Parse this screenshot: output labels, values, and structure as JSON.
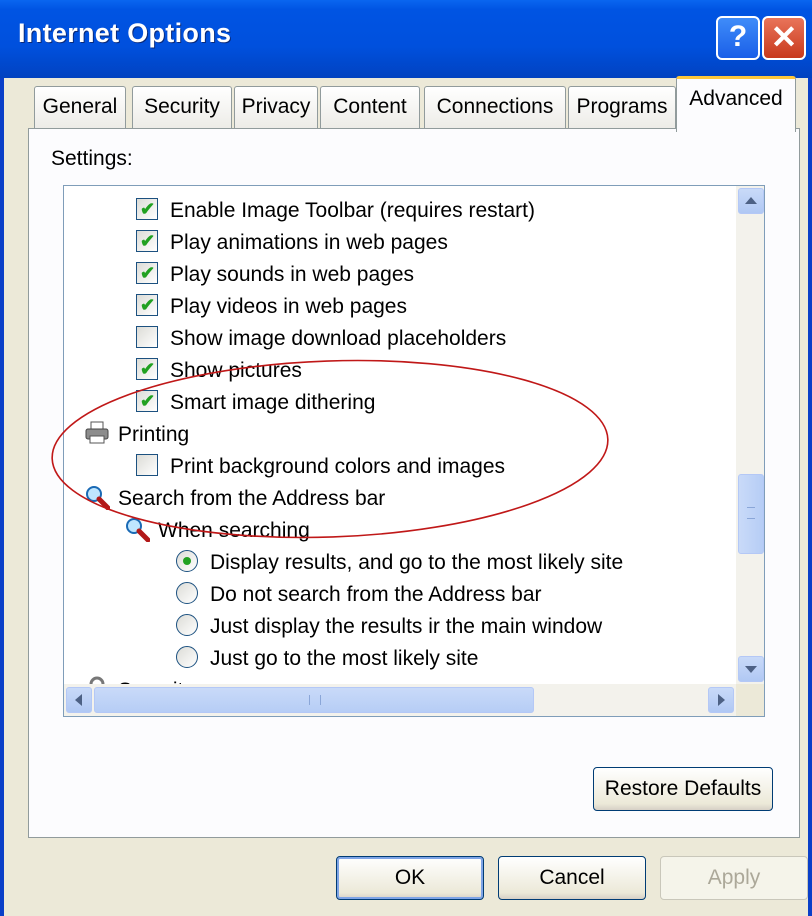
{
  "window": {
    "title": "Internet Options",
    "help_glyph": "?",
    "close_glyph": "✕"
  },
  "tabs": [
    {
      "label": "General"
    },
    {
      "label": "Security"
    },
    {
      "label": "Privacy"
    },
    {
      "label": "Content"
    },
    {
      "label": "Connections"
    },
    {
      "label": "Programs"
    },
    {
      "label": "Advanced",
      "active": true
    }
  ],
  "settings": {
    "label": "Settings:",
    "items": [
      {
        "type": "checkbox",
        "checked": true,
        "label": "Enable Image Toolbar (requires restart)"
      },
      {
        "type": "checkbox",
        "checked": true,
        "label": "Play animations in web pages"
      },
      {
        "type": "checkbox",
        "checked": true,
        "label": "Play sounds in web pages"
      },
      {
        "type": "checkbox",
        "checked": true,
        "label": "Play videos in web pages"
      },
      {
        "type": "checkbox",
        "checked": false,
        "label": "Show image download placeholders"
      },
      {
        "type": "checkbox",
        "checked": true,
        "label": "Show pictures"
      },
      {
        "type": "checkbox",
        "checked": true,
        "label": "Smart image dithering"
      },
      {
        "type": "category",
        "icon": "printer-icon",
        "label": "Printing"
      },
      {
        "type": "checkbox",
        "checked": false,
        "label": "Print background colors and images"
      },
      {
        "type": "category",
        "icon": "magnifier-icon",
        "label": "Search from the Address bar"
      },
      {
        "type": "subcategory",
        "icon": "magnifier-icon",
        "label": "When searching"
      },
      {
        "type": "radio",
        "selected": true,
        "label": "Display results, and go to the most likely site"
      },
      {
        "type": "radio",
        "selected": false,
        "label": "Do not search from the Address bar"
      },
      {
        "type": "radio",
        "selected": false,
        "label": "Just display the results ir the main window"
      },
      {
        "type": "radio",
        "selected": false,
        "label": "Just go to the most likely site"
      },
      {
        "type": "category",
        "icon": "lock-icon",
        "label": "Security"
      }
    ]
  },
  "buttons": {
    "restore_defaults": "Restore Defaults",
    "ok": "OK",
    "cancel": "Cancel",
    "apply": "Apply"
  },
  "annotation": {
    "shape": "ellipse",
    "color": "#c01818"
  },
  "colors": {
    "titlebar": "#0054e3",
    "check": "#21a121",
    "active_tab_accent": "#ffc83c"
  }
}
